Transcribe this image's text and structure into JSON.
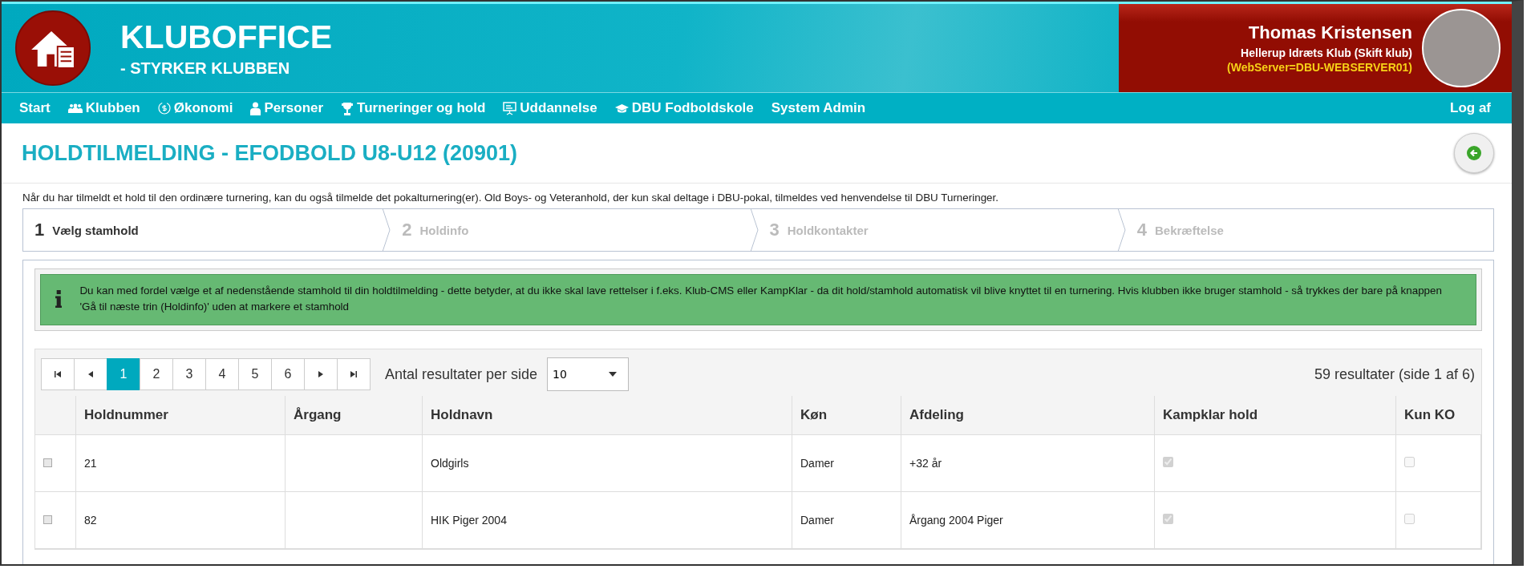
{
  "header": {
    "title": "KLUBOFFICE",
    "subtitle": "- STYRKER KLUBBEN",
    "user": {
      "name": "Thomas Kristensen",
      "club": "Hellerup Idræts Klub (Skift klub)",
      "server": "(WebServer=DBU-WEBSERVER01)"
    }
  },
  "nav": {
    "items": [
      {
        "label": "Start",
        "kind": "plain"
      },
      {
        "label": "Klubben",
        "kind": "club"
      },
      {
        "label": "Økonomi",
        "kind": "economy"
      },
      {
        "label": "Personer",
        "kind": "persons"
      },
      {
        "label": "Turneringer og hold",
        "kind": "tournaments"
      },
      {
        "label": "Uddannelse",
        "kind": "education"
      },
      {
        "label": "DBU Fodboldskole",
        "kind": "school"
      },
      {
        "label": "System Admin",
        "kind": "plain"
      }
    ],
    "logout": "Log af"
  },
  "page": {
    "title": "HOLDTILMELDING - EFODBOLD U8-U12 (20901)",
    "intro": "Når du har tilmeldt et hold til den ordinære turnering, kan du også tilmelde det pokalturnering(er). Old Boys- og Veteranhold, der kun skal deltage i DBU-pokal, tilmeldes ved henvendelse til DBU Turneringer."
  },
  "steps": [
    {
      "number": "1",
      "label": "Vælg stamhold",
      "selected": true
    },
    {
      "number": "2",
      "label": "Holdinfo",
      "selected": false
    },
    {
      "number": "3",
      "label": "Holdkontakter",
      "selected": false
    },
    {
      "number": "4",
      "label": "Bekræftelse",
      "selected": false
    }
  ],
  "info": "Du kan med fordel vælge et af nedenstående stamhold til din holdtilmelding - dette betyder, at du ikke skal lave rettelser i f.eks. Klub-CMS eller KampKlar - da dit hold/stamhold automatisk vil blive knyttet til en turnering. Hvis klubben ikke bruger stamhold - så trykkes der bare på knappen 'Gå til næste trin (Holdinfo)' uden at markere et stamhold",
  "pager": {
    "pages": [
      {
        "label": "1",
        "selected": true
      },
      {
        "label": "2",
        "selected": false
      },
      {
        "label": "3",
        "selected": false
      },
      {
        "label": "4",
        "selected": false
      },
      {
        "label": "5",
        "selected": false
      },
      {
        "label": "6",
        "selected": false
      }
    ],
    "per_page_label": "Antal resultater per side",
    "per_page": "10",
    "summary": "59 resultater (side 1 af 6)"
  },
  "table": {
    "columns": [
      "Holdnummer",
      "Årgang",
      "Holdnavn",
      "Køn",
      "Afdeling",
      "Kampklar hold",
      "Kun KO"
    ],
    "rows": [
      {
        "number": "21",
        "year": "",
        "name": "Oldgirls",
        "gender": "Damer",
        "division": "+32 år",
        "kampklar": true,
        "kun_ko": false
      },
      {
        "number": "82",
        "year": "",
        "name": "HIK Piger 2004",
        "gender": "Damer",
        "division": "Årgang 2004 Piger",
        "kampklar": true,
        "kun_ko": false
      }
    ]
  }
}
